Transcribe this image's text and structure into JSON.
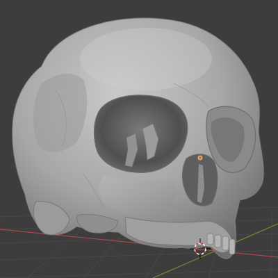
{
  "viewport": {
    "background_color": "#3d3d3d",
    "grid_color": "#4a4a4a",
    "x_axis_color": "#b0474f",
    "y_axis_color": "#6a8f2f"
  },
  "object": {
    "type": "skull-mesh",
    "shading": "solid",
    "base_color": "#a8a8a8"
  },
  "origin_marker": {
    "color": "#e07a1f"
  },
  "cursor_3d": {
    "ring_colors": [
      "#c83a3a",
      "#ffffff"
    ]
  }
}
